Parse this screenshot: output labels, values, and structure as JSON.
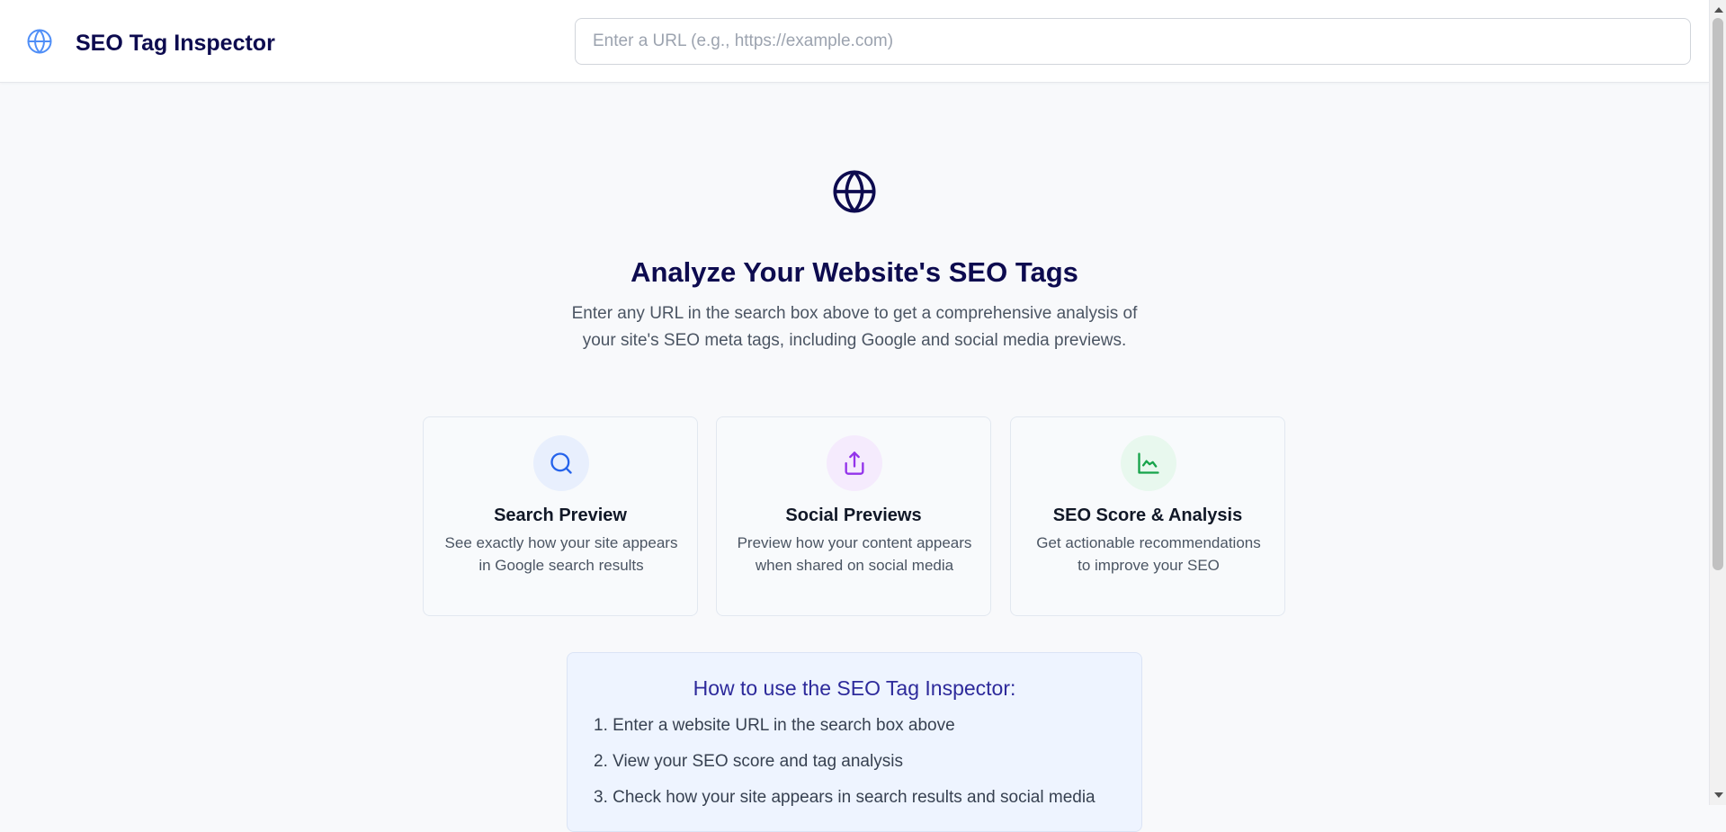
{
  "header": {
    "title": "SEO Tag Inspector",
    "brand_icon": "globe-icon",
    "search_placeholder": "Enter a URL (e.g., https://example.com)",
    "search_value": ""
  },
  "hero": {
    "icon": "globe-icon",
    "title": "Analyze Your Website's SEO Tags",
    "description": "Enter any URL in the search box above to get a comprehensive analysis of your site's SEO meta tags, including Google and social media previews."
  },
  "features": [
    {
      "icon": "search-icon",
      "title": "Search Preview",
      "description": "See exactly how your site appears in Google search results",
      "accent": "#2563eb",
      "bg": "#e8effd"
    },
    {
      "icon": "share-icon",
      "title": "Social Previews",
      "description": "Preview how your content appears when shared on social media",
      "accent": "#9333ea",
      "bg": "#f5ebfd"
    },
    {
      "icon": "chart-icon",
      "title": "SEO Score & Analysis",
      "description": "Get actionable recommendations to improve your SEO",
      "accent": "#16a34a",
      "bg": "#e8f8ee"
    }
  ],
  "howto": {
    "title": "How to use the SEO Tag Inspector:",
    "steps": [
      "1. Enter a website URL in the search box above",
      "2. View your SEO score and tag analysis",
      "3. Check how your site appears in search results and social media"
    ]
  },
  "colors": {
    "brand": "#0d0b4f",
    "brand_icon": "#3b82f6",
    "howto_title": "#2d2a9b"
  }
}
